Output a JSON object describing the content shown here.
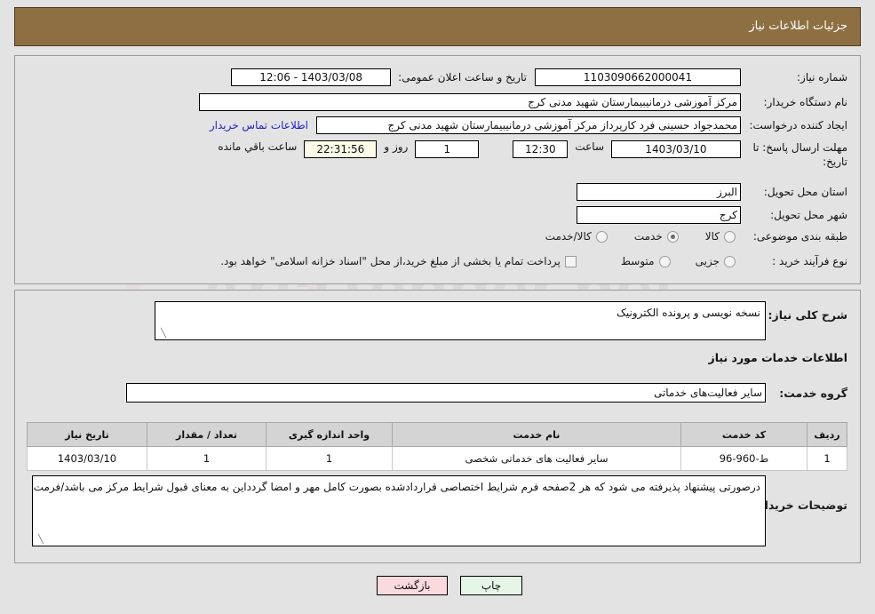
{
  "header": {
    "title": "جزئیات اطلاعات نیاز"
  },
  "form": {
    "need_number_label": "شماره نیاز:",
    "need_number_value": "1103090662000041",
    "announce_label": "تاریخ و ساعت اعلان عمومی:",
    "announce_value": "1403/03/08 - 12:06",
    "buyer_org_label": "نام دستگاه خریدار:",
    "buyer_org_value": "مرکز آموزشی درمانیبیمارستان شهید مدنی کرج",
    "requester_label": "ایجاد کننده درخواست:",
    "requester_value": "محمدجواد حسینی فرد کارپرداز مرکز آموزشی درمانیبیمارستان شهید مدنی کرج",
    "contact_link": "اطلاعات تماس خریدار",
    "deadline_label": "مهلت ارسال پاسخ: تا تاریخ:",
    "deadline_date": "1403/03/10",
    "deadline_hour_label": "ساعت",
    "deadline_time": "12:30",
    "days_value": "1",
    "days_sep_label": "روز و",
    "countdown_value": "22:31:56",
    "countdown_suffix": "ساعت باقي مانده",
    "province_label": "استان محل تحویل:",
    "province_value": "البرز",
    "city_label": "شهر محل تحویل:",
    "city_value": "کرج",
    "category_label": "طبقه بندی موضوعی:",
    "category_options": [
      {
        "label": "کالا",
        "selected": false
      },
      {
        "label": "خدمت",
        "selected": true
      },
      {
        "label": "کالا/خدمت",
        "selected": false
      }
    ],
    "process_label": "نوع فرآیند خرید :",
    "process_options": [
      {
        "label": "جزیی",
        "selected": false
      },
      {
        "label": "متوسط",
        "selected": false
      }
    ],
    "treasury_checkbox_label": "پرداخت تمام یا بخشی از مبلغ خرید،از محل \"اسناد خزانه اسلامی\" خواهد بود.",
    "treasury_checked": false
  },
  "description": {
    "label": "شرح کلی نیاز:",
    "value": "نسخه نویسی و پرونده الکترونیک"
  },
  "services": {
    "section_title": "اطلاعات خدمات مورد نیاز",
    "group_label": "گروه خدمت:",
    "group_value": "سایر فعالیت‌های خدماتی",
    "columns": [
      "ردیف",
      "کد خدمت",
      "نام خدمت",
      "واحد اندازه گیری",
      "تعداد / مقدار",
      "تاریخ نیاز"
    ],
    "rows": [
      {
        "radif": "1",
        "code": "ط-960-96",
        "name": "سایر فعالیت های خدماتی شخصی",
        "unit": "1",
        "qty": "1",
        "date": "1403/03/10"
      }
    ]
  },
  "notes": {
    "label": "توضیحات خریدار:",
    "value": "درصورتی پیشنهاد پذیرفته می شود که هر 2صفحه فرم شرایط اختصاصی قراردادشده بصورت کامل مهر و امضا گردد‌این به معنای قبول شرایط مرکز می باشد/فرمت قرارداد نیز مطالعه گردد"
  },
  "footer": {
    "print_label": "چاپ",
    "back_label": "بازگشت"
  },
  "watermark": {
    "text": "AriaTender.net"
  },
  "colors": {
    "header_bg": "#8d6f42",
    "page_bg": "#e3e3e3",
    "link": "#2222cc",
    "print_btn": "#e6f6e6",
    "back_btn": "#fadadd",
    "countdown_bg": "#fbfbe8"
  }
}
